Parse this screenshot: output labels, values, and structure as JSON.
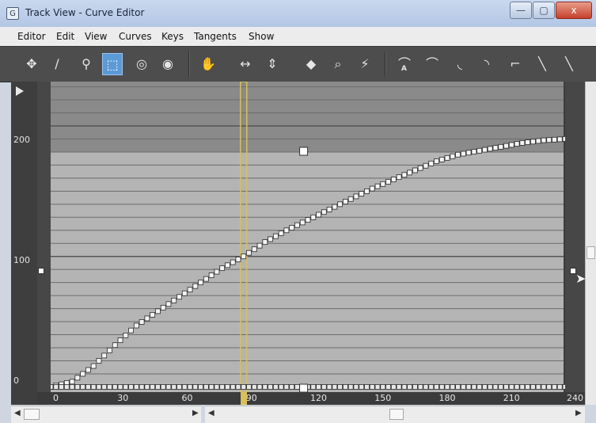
{
  "window": {
    "title": "Track View - Curve Editor",
    "icon_glyph": "G"
  },
  "title_buttons": {
    "min": "—",
    "max": "▢",
    "close": "x"
  },
  "menu": [
    {
      "label": "Editor"
    },
    {
      "label": "Edit"
    },
    {
      "label": "View"
    },
    {
      "label": "Curves"
    },
    {
      "label": "Keys"
    },
    {
      "label": "Tangents"
    },
    {
      "label": "Show"
    }
  ],
  "toolbar": {
    "items": [
      {
        "name": "move-keys-icon",
        "glyph": "✥"
      },
      {
        "name": "draw-curves-icon",
        "glyph": "∕"
      },
      {
        "name": "add-keys-icon",
        "glyph": "⚲"
      },
      {
        "name": "region-select-icon",
        "glyph": "⬚",
        "active": true
      },
      {
        "name": "retime-icon",
        "glyph": "◎"
      },
      {
        "name": "retime-global-icon",
        "glyph": "◉"
      },
      {
        "name": "pan-hand-icon",
        "glyph": "✋"
      },
      {
        "name": "fit-horizontal-icon",
        "glyph": "↔"
      },
      {
        "name": "fit-vertical-icon",
        "glyph": "⇕"
      },
      {
        "name": "isolate-curve-icon",
        "glyph": "◆"
      },
      {
        "name": "zoom-region-icon",
        "glyph": "⌕"
      },
      {
        "name": "reduce-keys-icon",
        "glyph": "⚡"
      },
      {
        "name": "tangent-auto-icon",
        "glyph": "⌒"
      },
      {
        "name": "tangent-custom-icon",
        "glyph": "⌒"
      },
      {
        "name": "tangent-fast-icon",
        "glyph": "◟"
      },
      {
        "name": "tangent-slow-icon",
        "glyph": "◝"
      },
      {
        "name": "tangent-step-icon",
        "glyph": "⌐"
      },
      {
        "name": "tangent-linear-icon",
        "glyph": "╲"
      },
      {
        "name": "tangent-smooth-icon",
        "glyph": "╲"
      }
    ],
    "auto_label": "A"
  },
  "graph": {
    "y_ticks": [
      "200",
      "100",
      "0"
    ],
    "x_ticks": [
      "0",
      "30",
      "60",
      "90",
      "120",
      "150",
      "180",
      "210",
      "240"
    ],
    "current_frame": 90,
    "colors": {
      "band_dark": "#8a8a8a",
      "band_light": "#b4b4b4",
      "timeline": "#d8c05a",
      "curve_key": "#f4f4f4"
    }
  },
  "chart_data": {
    "type": "line",
    "x": [
      0,
      10,
      20,
      30,
      40,
      50,
      60,
      70,
      80,
      90,
      100,
      110,
      120,
      130,
      140,
      150,
      160,
      170,
      180,
      190,
      200,
      210,
      220,
      230,
      240
    ],
    "series": [
      {
        "values": [
          0,
          4,
          16,
          32,
          47,
          58,
          69,
          80,
          91,
          100,
          111,
          120,
          128,
          136,
          144,
          152,
          159,
          166,
          173,
          178,
          181,
          184,
          187,
          189,
          190
        ]
      },
      {
        "values": [
          0,
          0,
          0,
          0,
          0,
          0,
          0,
          0,
          0,
          0,
          0,
          0,
          0,
          0,
          0,
          0,
          0,
          0,
          0,
          0,
          0,
          0,
          0,
          0,
          0
        ]
      }
    ],
    "xlim": [
      0,
      240
    ],
    "ylim": [
      -4,
      234
    ],
    "grid": true
  }
}
